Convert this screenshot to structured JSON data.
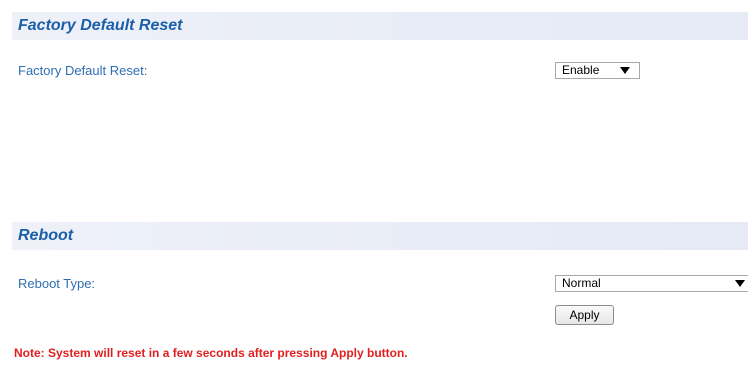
{
  "factory_reset": {
    "section_title": "Factory Default Reset",
    "field_label": "Factory Default Reset:",
    "selected_value": "Enable",
    "arrow_icon": "triangle-down-icon"
  },
  "reboot": {
    "section_title": "Reboot",
    "field_label": "Reboot Type:",
    "selected_value": "Normal",
    "arrow_icon": "triangle-down-icon",
    "apply_label": "Apply"
  },
  "note": "Note: System will reset in a few seconds after pressing Apply button.",
  "colors": {
    "header_bg": "#e8ecf6",
    "title": "#1a5fa8",
    "label": "#2e6fb4",
    "note": "#e02020"
  }
}
